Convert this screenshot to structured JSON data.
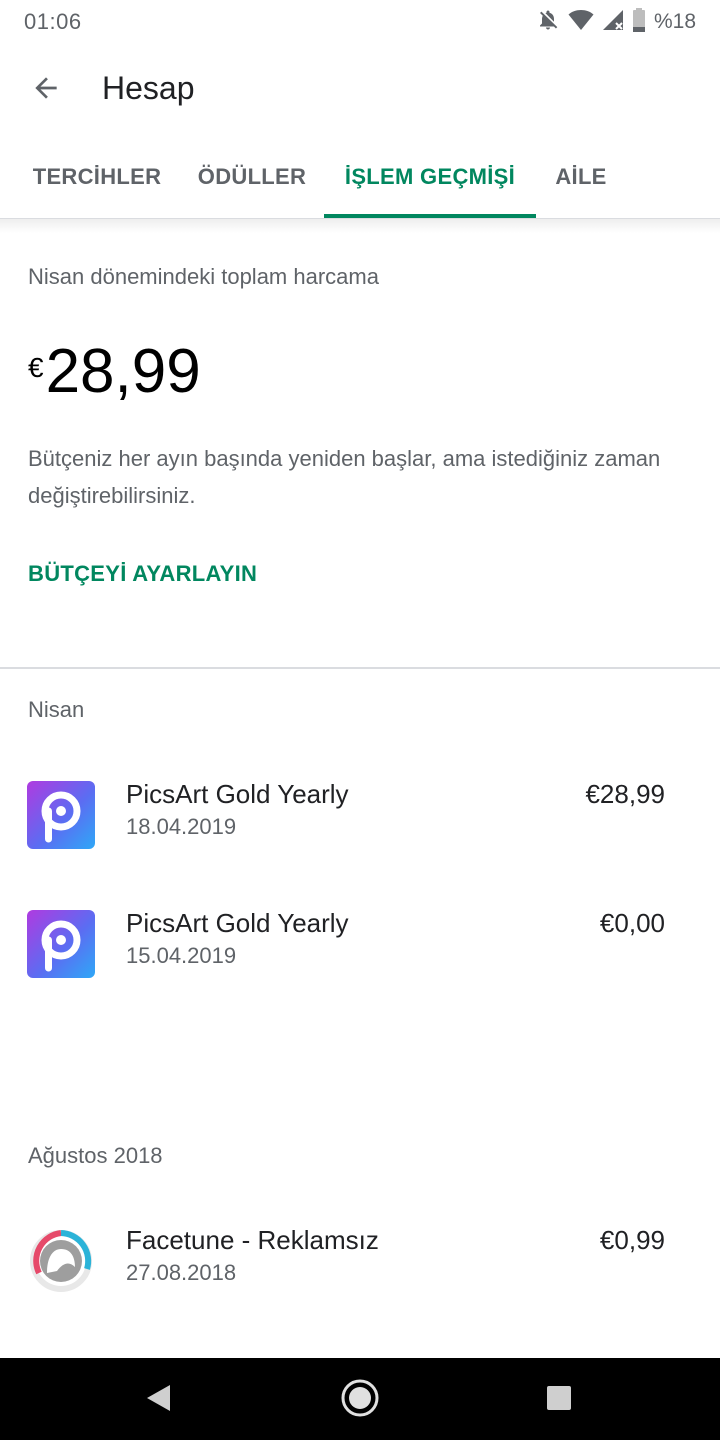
{
  "status_bar": {
    "time": "01:06",
    "battery_text": "%18",
    "icons": [
      "bell-off-icon",
      "wifi-icon",
      "signal-icon",
      "battery-icon"
    ]
  },
  "app_bar": {
    "back_icon": "arrow-back-icon",
    "title": "Hesap"
  },
  "tabs": [
    {
      "label": "TERCİHLER",
      "active": false
    },
    {
      "label": "ÖDÜLLER",
      "active": false
    },
    {
      "label": "İŞLEM GEÇMİŞİ",
      "active": true
    },
    {
      "label": "AİLE",
      "active": false
    }
  ],
  "accent_color": "#01875f",
  "summary": {
    "label": "Nisan dönemindeki toplam harcama",
    "currency": "€",
    "amount": "28,99",
    "description": "Bütçeniz her ayın başında yeniden başlar, ama istediğiniz zaman değiştirebilirsiniz.",
    "budget_link": "BÜTÇEYİ AYARLAYIN"
  },
  "sections": [
    {
      "header": "Nisan",
      "items": [
        {
          "icon": "picsart-app-icon",
          "name": "PicsArt Gold Yearly",
          "date": "18.04.2019",
          "price": "€28,99"
        },
        {
          "icon": "picsart-app-icon",
          "name": "PicsArt Gold Yearly",
          "date": "15.04.2019",
          "price": "€0,00"
        }
      ]
    },
    {
      "header": "Ağustos 2018",
      "items": [
        {
          "icon": "facetune-app-icon",
          "name": "Facetune - Reklamsız",
          "date": "27.08.2018",
          "price": "€0,99"
        }
      ]
    }
  ],
  "nav_bar": {
    "buttons": [
      "back-triangle-icon",
      "home-circle-icon",
      "recents-square-icon"
    ]
  }
}
